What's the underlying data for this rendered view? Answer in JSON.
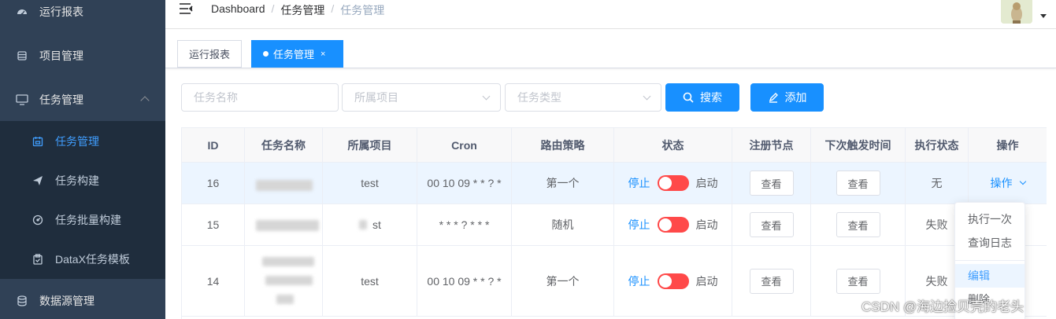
{
  "sidebar": {
    "items": [
      {
        "label": "运行报表"
      },
      {
        "label": "项目管理"
      },
      {
        "label": "任务管理"
      },
      {
        "label": "任务管理"
      },
      {
        "label": "任务构建"
      },
      {
        "label": "任务批量构建"
      },
      {
        "label": "DataX任务模板"
      },
      {
        "label": "数据源管理"
      }
    ]
  },
  "header": {
    "breadcrumb": [
      "Dashboard",
      "/",
      "任务管理",
      "/",
      "任务管理"
    ]
  },
  "tags": [
    {
      "label": "运行报表"
    },
    {
      "label": "任务管理",
      "close": "×"
    }
  ],
  "filters": {
    "task_name_placeholder": "任务名称",
    "project_placeholder": "所属项目",
    "task_type_placeholder": "任务类型",
    "search_label": "搜索",
    "add_label": "添加"
  },
  "table": {
    "headers": [
      "ID",
      "任务名称",
      "所属项目",
      "Cron",
      "路由策略",
      "状态",
      "注册节点",
      "下次触发时间",
      "执行状态",
      "操作"
    ],
    "rows": [
      {
        "id": "16",
        "project": "test",
        "cron": "00 10 09 * * ? *",
        "route": "第一个",
        "stop": "停止",
        "start": "启动",
        "node": "查看",
        "next": "查看",
        "exec": "无",
        "op": "操作"
      },
      {
        "id": "15",
        "project": "st",
        "cron": "* * * ? * * *",
        "route": "随机",
        "stop": "停止",
        "start": "启动",
        "node": "查看",
        "next": "查看",
        "exec": "失败"
      },
      {
        "id": "14",
        "project": "test",
        "cron": "00 10 09 * * ? *",
        "route": "第一个",
        "stop": "停止",
        "start": "启动",
        "node": "查看",
        "next": "查看",
        "exec": "失败"
      }
    ]
  },
  "dropdown": {
    "items": [
      "执行一次",
      "查询日志",
      "编辑",
      "删除"
    ]
  },
  "watermark": "CSDN @海边捡贝壳的老头",
  "colors": {
    "primary": "#1890ff",
    "sidebar": "#304156",
    "switch_off": "#ff4949"
  }
}
